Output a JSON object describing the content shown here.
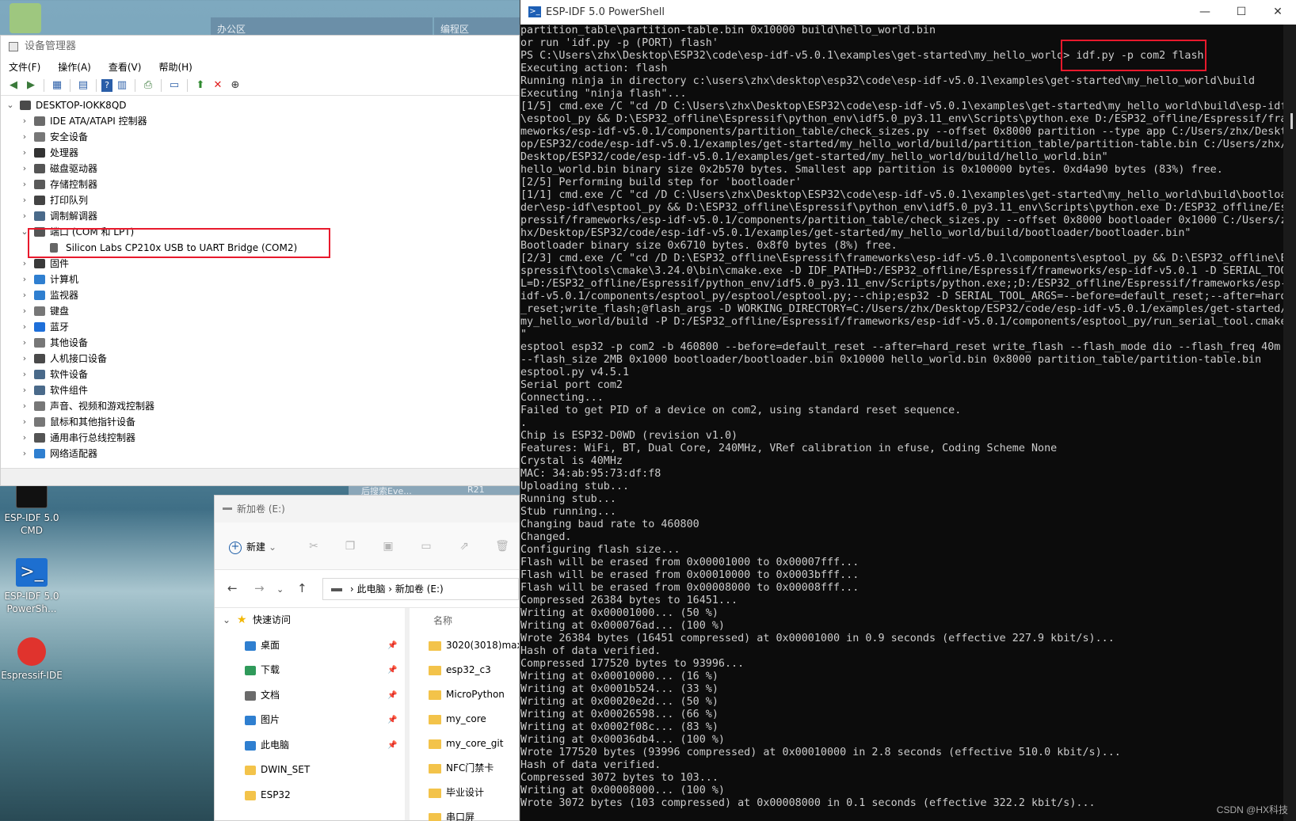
{
  "desktop": {
    "top_tabs": [
      "办公区",
      "编程区"
    ],
    "icons": [
      {
        "label": "ESP-IDF 5.0 CMD"
      },
      {
        "label": "ESP-IDF 5.0 PowerSh..."
      },
      {
        "label": "Espressif-IDE"
      }
    ],
    "strip_texts": [
      "后搜索Eve...",
      "R21"
    ],
    "watermark": "CSDN @HX科技"
  },
  "device_manager": {
    "title": "设备管理器",
    "menu": [
      "文件(F)",
      "操作(A)",
      "查看(V)",
      "帮助(H)"
    ],
    "toolbar_icons": [
      "back-icon",
      "forward-icon",
      "properties-icon",
      "view-icon",
      "help-icon",
      "list-icon",
      "print-icon",
      "monitor-icon",
      "update-driver-icon",
      "uninstall-icon",
      "download-icon"
    ],
    "root": "DESKTOP-IOKK8QD",
    "nodes": [
      {
        "label": "IDE ATA/ATAPI 控制器",
        "expanded": false
      },
      {
        "label": "安全设备",
        "expanded": false
      },
      {
        "label": "处理器",
        "expanded": false
      },
      {
        "label": "磁盘驱动器",
        "expanded": false
      },
      {
        "label": "存储控制器",
        "expanded": false
      },
      {
        "label": "打印队列",
        "expanded": false
      },
      {
        "label": "调制解调器",
        "expanded": false
      },
      {
        "label": "端口 (COM 和 LPT)",
        "expanded": true,
        "children": [
          "Silicon Labs CP210x USB to UART Bridge (COM2)"
        ]
      },
      {
        "label": "固件",
        "expanded": false
      },
      {
        "label": "计算机",
        "expanded": false
      },
      {
        "label": "监视器",
        "expanded": false
      },
      {
        "label": "键盘",
        "expanded": false
      },
      {
        "label": "蓝牙",
        "expanded": false
      },
      {
        "label": "其他设备",
        "expanded": false
      },
      {
        "label": "人机接口设备",
        "expanded": false
      },
      {
        "label": "软件设备",
        "expanded": false
      },
      {
        "label": "软件组件",
        "expanded": false
      },
      {
        "label": "声音、视频和游戏控制器",
        "expanded": false
      },
      {
        "label": "鼠标和其他指针设备",
        "expanded": false
      },
      {
        "label": "通用串行总线控制器",
        "expanded": false
      },
      {
        "label": "网络适配器",
        "expanded": false
      }
    ]
  },
  "powershell": {
    "title": "ESP-IDF 5.0 PowerShell",
    "controls": [
      "—",
      "☐",
      "✕"
    ],
    "lines": [
      "partition_table\\partition-table.bin 0x10000 build\\hello_world.bin",
      "or run 'idf.py -p (PORT) flash'",
      "PS C:\\Users\\zhx\\Desktop\\ESP32\\code\\esp-idf-v5.0.1\\examples\\get-started\\my_hello_world> idf.py -p com2 flash",
      "Executing action: flash",
      "Running ninja in directory c:\\users\\zhx\\desktop\\esp32\\code\\esp-idf-v5.0.1\\examples\\get-started\\my_hello_world\\build",
      "Executing \"ninja flash\"...",
      "[1/5] cmd.exe /C \"cd /D C:\\Users\\zhx\\Desktop\\ESP32\\code\\esp-idf-v5.0.1\\examples\\get-started\\my_hello_world\\build\\esp-idf",
      "\\esptool_py && D:\\ESP32_offline\\Espressif\\python_env\\idf5.0_py3.11_env\\Scripts\\python.exe D:/ESP32_offline/Espressif/fra",
      "meworks/esp-idf-v5.0.1/components/partition_table/check_sizes.py --offset 0x8000 partition --type app C:/Users/zhx/Deskt",
      "op/ESP32/code/esp-idf-v5.0.1/examples/get-started/my_hello_world/build/partition_table/partition-table.bin C:/Users/zhx/",
      "Desktop/ESP32/code/esp-idf-v5.0.1/examples/get-started/my_hello_world/build/hello_world.bin\"",
      "hello_world.bin binary size 0x2b570 bytes. Smallest app partition is 0x100000 bytes. 0xd4a90 bytes (83%) free.",
      "[2/5] Performing build step for 'bootloader'",
      "[1/1] cmd.exe /C \"cd /D C:\\Users\\zhx\\Desktop\\ESP32\\code\\esp-idf-v5.0.1\\examples\\get-started\\my_hello_world\\build\\bootloa",
      "der\\esp-idf\\esptool_py && D:\\ESP32_offline\\Espressif\\python_env\\idf5.0_py3.11_env\\Scripts\\python.exe D:/ESP32_offline/Es",
      "pressif/frameworks/esp-idf-v5.0.1/components/partition_table/check_sizes.py --offset 0x8000 bootloader 0x1000 C:/Users/z",
      "hx/Desktop/ESP32/code/esp-idf-v5.0.1/examples/get-started/my_hello_world/build/bootloader/bootloader.bin\"",
      "Bootloader binary size 0x6710 bytes. 0x8f0 bytes (8%) free.",
      "[2/3] cmd.exe /C \"cd /D D:\\ESP32_offline\\Espressif\\frameworks\\esp-idf-v5.0.1\\components\\esptool_py && D:\\ESP32_offline\\E",
      "spressif\\tools\\cmake\\3.24.0\\bin\\cmake.exe -D IDF_PATH=D:/ESP32_offline/Espressif/frameworks/esp-idf-v5.0.1 -D SERIAL_TOO",
      "L=D:/ESP32_offline/Espressif/python_env/idf5.0_py3.11_env/Scripts/python.exe;;D:/ESP32_offline/Espressif/frameworks/esp-",
      "idf-v5.0.1/components/esptool_py/esptool/esptool.py;--chip;esp32 -D SERIAL_TOOL_ARGS=--before=default_reset;--after=hard",
      "_reset;write_flash;@flash_args -D WORKING_DIRECTORY=C:/Users/zhx/Desktop/ESP32/code/esp-idf-v5.0.1/examples/get-started/",
      "my_hello_world/build -P D:/ESP32_offline/Espressif/frameworks/esp-idf-v5.0.1/components/esptool_py/run_serial_tool.cmake",
      "\"",
      "esptool esp32 -p com2 -b 460800 --before=default_reset --after=hard_reset write_flash --flash_mode dio --flash_freq 40m",
      "--flash_size 2MB 0x1000 bootloader/bootloader.bin 0x10000 hello_world.bin 0x8000 partition_table/partition-table.bin",
      "esptool.py v4.5.1",
      "Serial port com2",
      "Connecting...",
      "Failed to get PID of a device on com2, using standard reset sequence.",
      ".",
      "Chip is ESP32-D0WD (revision v1.0)",
      "Features: WiFi, BT, Dual Core, 240MHz, VRef calibration in efuse, Coding Scheme None",
      "Crystal is 40MHz",
      "MAC: 34:ab:95:73:df:f8",
      "Uploading stub...",
      "Running stub...",
      "Stub running...",
      "Changing baud rate to 460800",
      "Changed.",
      "Configuring flash size...",
      "Flash will be erased from 0x00001000 to 0x00007fff...",
      "Flash will be erased from 0x00010000 to 0x0003bfff...",
      "Flash will be erased from 0x00008000 to 0x00008fff...",
      "Compressed 26384 bytes to 16451...",
      "Writing at 0x00001000... (50 %)",
      "Writing at 0x000076ad... (100 %)",
      "Wrote 26384 bytes (16451 compressed) at 0x00001000 in 0.9 seconds (effective 227.9 kbit/s)...",
      "Hash of data verified.",
      "Compressed 177520 bytes to 93996...",
      "Writing at 0x00010000... (16 %)",
      "Writing at 0x0001b524... (33 %)",
      "Writing at 0x00020e2d... (50 %)",
      "Writing at 0x00026598... (66 %)",
      "Writing at 0x0002f08c... (83 %)",
      "Writing at 0x00036db4... (100 %)",
      "Wrote 177520 bytes (93996 compressed) at 0x00010000 in 2.8 seconds (effective 510.0 kbit/s)...",
      "Hash of data verified.",
      "Compressed 3072 bytes to 103...",
      "Writing at 0x00008000... (100 %)",
      "Wrote 3072 bytes (103 compressed) at 0x00008000 in 0.1 seconds (effective 322.2 kbit/s)..."
    ]
  },
  "explorer": {
    "title": "新加卷 (E:)",
    "new_button": "新建",
    "address": [
      "此电脑",
      "新加卷 (E:)"
    ],
    "quick_access": "快速访问",
    "sidebar": [
      "桌面",
      "下载",
      "文档",
      "图片",
      "此电脑",
      "DWIN_SET",
      "ESP32"
    ],
    "column_header": "名称",
    "files": [
      "3020(3018)max",
      "esp32_c3",
      "MicroPython",
      "my_core",
      "my_core_git",
      "NFC门禁卡",
      "毕业设计",
      "串口屏"
    ]
  }
}
